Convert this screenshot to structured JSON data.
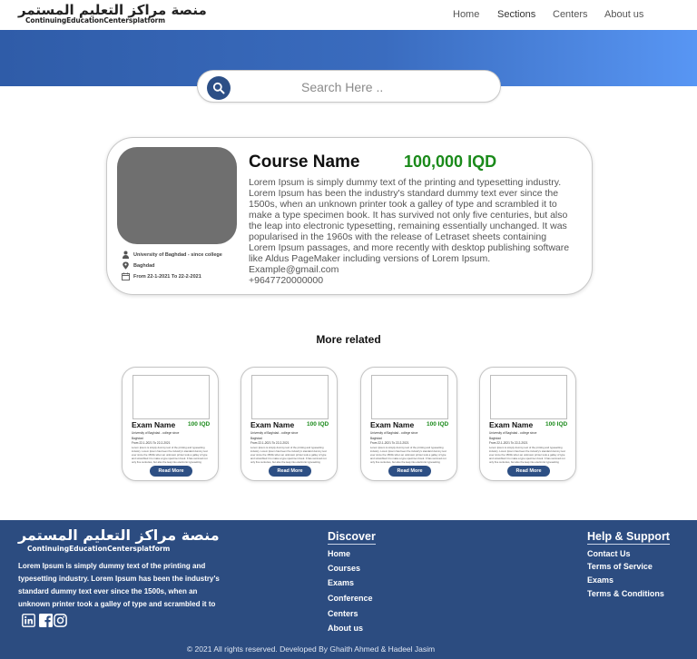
{
  "brand": {
    "arabic_name": "منصة مراكز التعليم المستمر",
    "english_name": "ContinuingEducationCentersplatform"
  },
  "nav": {
    "home": "Home",
    "sections": "Sections",
    "centers": "Centers",
    "about": "About us"
  },
  "search": {
    "placeholder": "Search Here .."
  },
  "course": {
    "name": "Course Name",
    "price": "100,000 IQD",
    "description": "Lorem Ipsum is simply dummy text of the printing and typesetting industry. Lorem Ipsum has been the industry's standard dummy text ever since the 1500s, when an unknown printer took a galley of type and scrambled it to make a type specimen book. It has survived not only five centuries, but also the leap into electronic typesetting, remaining essentially unchanged. It was popularised in the 1960s with the release of Letraset sheets containing Lorem Ipsum passages, and more recently with desktop publishing software like Aldus PageMaker including versions of Lorem Ipsum.",
    "email": "Example@gmail.com",
    "phone": "+9647720000000",
    "university": "University of Baghdad - since college",
    "location": "Baghdad",
    "dates": "From 22-1-2021 To 22-2-2021"
  },
  "related": {
    "title": "More related",
    "items": [
      {
        "name": "Exam Name",
        "price": "100 IQD",
        "university": "University of Baghdad - college since",
        "location": "Baghdad",
        "dates": "From 22-1-2021 To 22-2-2021",
        "text": "Lorem Ipsum is simply dummy text of the printing and typesetting industry. Lorem Ipsum has been the industry's standard dummy text ever since the 1500s when an unknown printer took a galley of type and scrambled it to make a type specimen book. It has survived not only five centuries, but also the leap into electronic typesetting remaining essentially unchanged.",
        "button": "Read More"
      },
      {
        "name": "Exam Name",
        "price": "100 IQD",
        "university": "University of Baghdad - college since",
        "location": "Baghdad",
        "dates": "From 22-1-2021 To 22-2-2021",
        "text": "Lorem Ipsum is simply dummy text of the printing and typesetting industry. Lorem Ipsum has been the industry's standard dummy text ever since the 1500s when an unknown printer took a galley of type and scrambled it to make a type specimen book. It has survived not only five centuries, but also the leap into electronic typesetting remaining essentially unchanged.",
        "button": "Read More"
      },
      {
        "name": "Exam Name",
        "price": "100 IQD",
        "university": "University of Baghdad - college since",
        "location": "Baghdad",
        "dates": "From 22-1-2021 To 22-2-2021",
        "text": "Lorem Ipsum is simply dummy text of the printing and typesetting industry. Lorem Ipsum has been the industry's standard dummy text ever since the 1500s when an unknown printer took a galley of type and scrambled it to make a type specimen book. It has survived not only five centuries, but also the leap into electronic typesetting remaining essentially unchanged.",
        "button": "Read More"
      },
      {
        "name": "Exam Name",
        "price": "100 IQD",
        "university": "University of Baghdad - college since",
        "location": "Baghdad",
        "dates": "From 22-1-2021 To 22-2-2021",
        "text": "Lorem Ipsum is simply dummy text of the printing and typesetting industry. Lorem Ipsum has been the industry's standard dummy text ever since the 1500s when an unknown printer took a galley of type and scrambled it to make a type specimen book. It has survived not only five centuries, but also the leap into electronic typesetting remaining essentially unchanged.",
        "button": "Read More"
      }
    ]
  },
  "footer": {
    "about": "Lorem Ipsum is simply dummy text of the printing and typesetting industry. Lorem Ipsum has been the industry's standard dummy text ever since the 1500s, when an unknown printer took a galley of type and scrambled it to",
    "discover": {
      "title": "Discover",
      "links": [
        "Home",
        "Courses",
        "Exams",
        "Conference",
        "Centers",
        "About us"
      ]
    },
    "help": {
      "title": "Help & Support",
      "links": [
        "Contact Us",
        "Terms of Service",
        "Exams",
        "Terms & Conditions"
      ]
    },
    "social_icons": [
      "linkedin-icon",
      "facebook-icon",
      "instagram-icon"
    ],
    "copyright": "© 2021 All rights reserved. Developed By Ghaith Ahmed & Hadeel Jasim"
  },
  "colors": {
    "primary": "#2c4c80",
    "hero_start": "#2f5ca8",
    "hero_end": "#5896f4",
    "price_green": "#1a8a1a"
  }
}
